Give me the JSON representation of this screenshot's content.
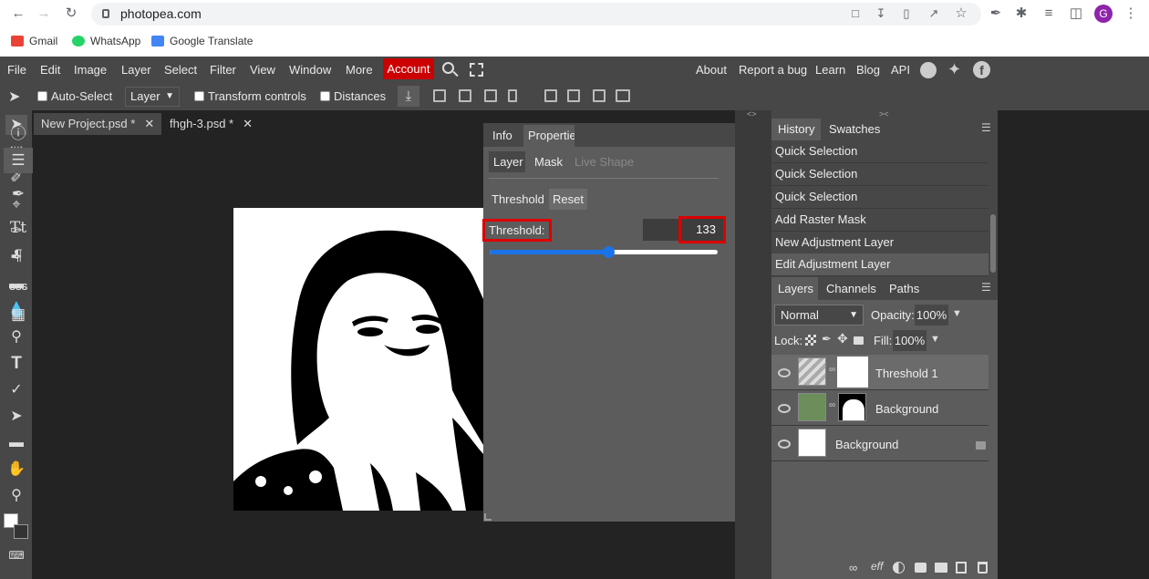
{
  "browser": {
    "url": "photopea.com",
    "bookmarks": [
      "Gmail",
      "WhatsApp",
      "Google Translate"
    ],
    "profile_initial": "G"
  },
  "menubar": {
    "items": [
      "File",
      "Edit",
      "Image",
      "Layer",
      "Select",
      "Filter",
      "View",
      "Window",
      "More"
    ],
    "account": "Account",
    "right_links": [
      "About",
      "Report a bug",
      "Learn",
      "Blog",
      "API"
    ]
  },
  "options": {
    "auto_select": "Auto-Select",
    "layer_select": "Layer",
    "transform_controls": "Transform controls",
    "distances": "Distances"
  },
  "documents": {
    "tabs": [
      "New Project.psd *",
      "fhgh-3.psd *"
    ]
  },
  "properties": {
    "tabs": [
      "Info",
      "Properties"
    ],
    "subtabs": [
      "Layer",
      "Mask",
      "Live Shape"
    ],
    "adjustment_name": "Threshold",
    "reset_label": "Reset",
    "threshold_label": "Threshold:",
    "threshold_value": "133",
    "slider_fraction": 0.52
  },
  "history": {
    "tabs": [
      "History",
      "Swatches"
    ],
    "items": [
      "Quick Selection",
      "Quick Selection",
      "Quick Selection",
      "Add Raster Mask",
      "New Adjustment Layer",
      "Edit Adjustment Layer"
    ]
  },
  "layers": {
    "tabs": [
      "Layers",
      "Channels",
      "Paths"
    ],
    "blend_mode": "Normal",
    "opacity_label": "Opacity:",
    "opacity_value": "100%",
    "lock_label": "Lock:",
    "fill_label": "Fill:",
    "fill_value": "100%",
    "items": [
      "Threshold 1",
      "Background",
      "Background"
    ]
  },
  "colors": {
    "accent_red": "#cc0000",
    "slider_blue": "#1a73e8",
    "panel_bg": "#474747"
  }
}
